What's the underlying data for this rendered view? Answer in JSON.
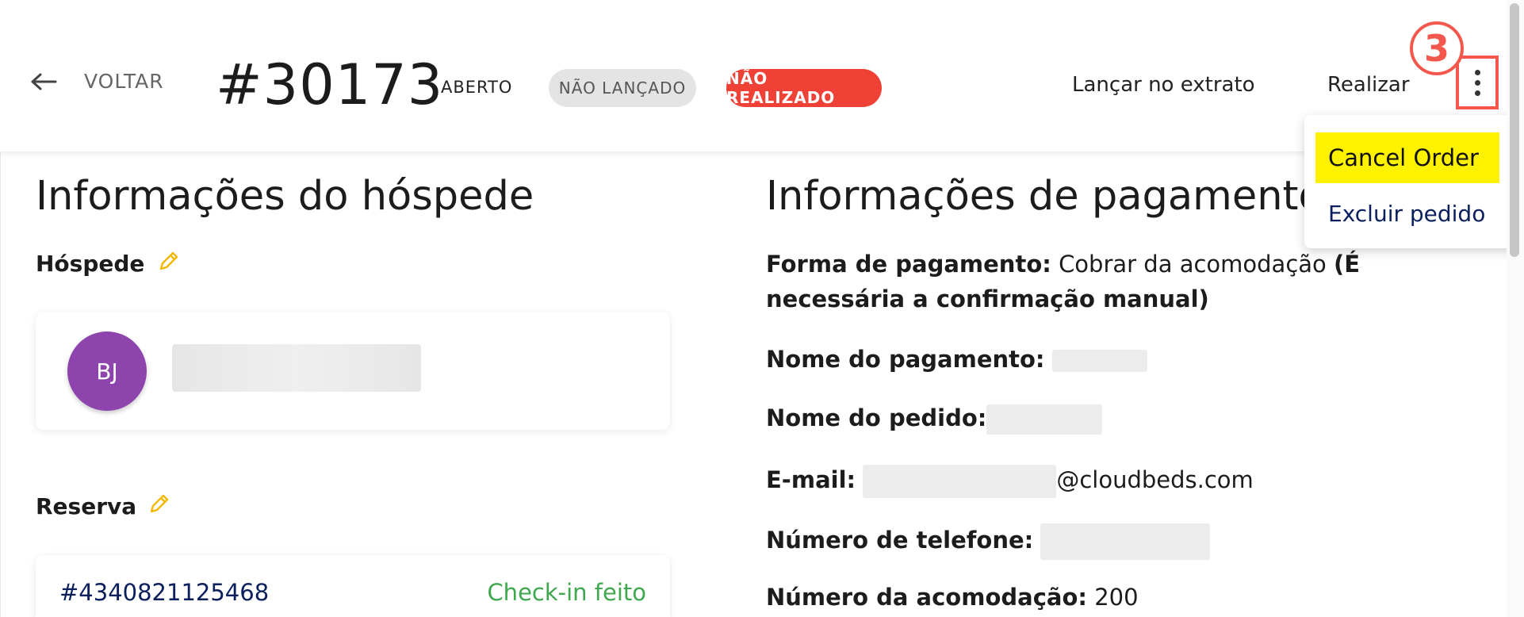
{
  "header": {
    "back_label": "VOLTAR",
    "order_number": "#30173",
    "status_open": "ABERTO",
    "status_not_posted": "NÃO LANÇADO",
    "status_not_done": "NÃO REALIZADO",
    "post_to_folio": "Lançar no extrato",
    "complete": "Realizar"
  },
  "annotation": {
    "step_number": "3"
  },
  "dropdown": {
    "cancel_label": "Cancel Order",
    "delete_label": "Excluir pedido"
  },
  "guest_section": {
    "title": "Informações do hóspede",
    "guest_label": "Hóspede",
    "avatar_initials": "BJ",
    "reservation_label": "Reserva",
    "reservation_id": "#4340821125468",
    "reservation_status": "Check-in feito"
  },
  "payment_section": {
    "title": "Informações de pagamento",
    "method_label": "Forma de pagamento:",
    "method_value": "Cobrar da acomodação",
    "method_note_1": "(É",
    "method_note_2": "necessária a confirmação manual)",
    "payment_name_label": "Nome do pagamento:",
    "order_name_label": "Nome do pedido:",
    "email_label": "E-mail:",
    "email_domain": "@cloudbeds.com",
    "phone_label": "Número de telefone:",
    "room_label": "Número da acomodação:",
    "room_value": "200"
  },
  "colors": {
    "accent_red": "#ef4136",
    "avatar_purple": "#8e44ad",
    "checkin_green": "#3fa84f",
    "highlight_yellow": "#fff200",
    "annotation_red": "#f4574b"
  }
}
